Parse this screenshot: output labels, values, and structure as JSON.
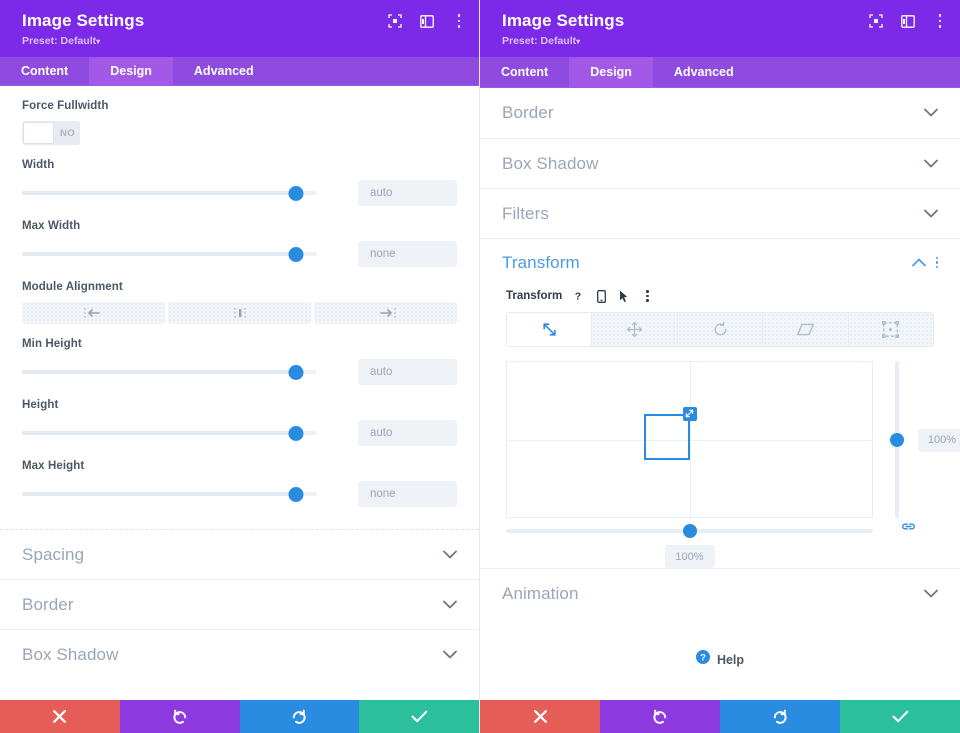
{
  "panels": [
    {
      "header": {
        "title": "Image Settings",
        "preset": "Preset: Default",
        "caret": "▾"
      },
      "tabs": [
        {
          "label": "Content",
          "active": false
        },
        {
          "label": "Design",
          "active": true
        },
        {
          "label": "Advanced",
          "active": false
        }
      ],
      "fields": [
        {
          "label": "Force Fullwidth",
          "type": "toggle",
          "value": "NO"
        },
        {
          "label": "Width",
          "type": "slider",
          "value": "auto",
          "thumb_pct": 93
        },
        {
          "label": "Max Width",
          "type": "slider",
          "value": "none",
          "thumb_pct": 93
        },
        {
          "label": "Module Alignment",
          "type": "align",
          "options": [
            "align-left",
            "align-center",
            "align-right"
          ]
        },
        {
          "label": "Min Height",
          "type": "slider",
          "value": "auto",
          "thumb_pct": 93
        },
        {
          "label": "Height",
          "type": "slider",
          "value": "auto",
          "thumb_pct": 93
        },
        {
          "label": "Max Height",
          "type": "slider",
          "value": "none",
          "thumb_pct": 93
        }
      ],
      "sections": [
        {
          "label": "Spacing",
          "open": false
        },
        {
          "label": "Border",
          "open": false
        },
        {
          "label": "Box Shadow",
          "open": false
        }
      ]
    },
    {
      "header": {
        "title": "Image Settings",
        "preset": "Preset: Default",
        "caret": "▾"
      },
      "tabs": [
        {
          "label": "Content",
          "active": false
        },
        {
          "label": "Design",
          "active": true
        },
        {
          "label": "Advanced",
          "active": false
        }
      ],
      "sections_top": [
        {
          "label": "Border",
          "open": false
        },
        {
          "label": "Box Shadow",
          "open": false
        },
        {
          "label": "Filters",
          "open": false
        }
      ],
      "transform": {
        "section_label": "Transform",
        "sub_label": "Transform",
        "meta_icons": [
          "help-icon",
          "mobile-icon",
          "cursor-icon",
          "more-options-icon"
        ],
        "modes": [
          {
            "name": "scale-icon",
            "active": true
          },
          {
            "name": "move-icon",
            "active": false
          },
          {
            "name": "rotate-icon",
            "active": false
          },
          {
            "name": "skew-icon",
            "active": false
          },
          {
            "name": "origin-icon",
            "active": false
          }
        ],
        "vertical_value": "100%",
        "horizontal_value": "100%",
        "vertical_thumb_pct": 50,
        "horizontal_thumb_pct": 50,
        "link_icon": "link-icon"
      },
      "sections_bottom": [
        {
          "label": "Animation",
          "open": false
        }
      ],
      "help": {
        "label": "Help",
        "icon": "help-circle-icon"
      }
    }
  ],
  "footer": {
    "buttons": [
      {
        "name": "cancel-button",
        "icon": "✖",
        "class": "cancel"
      },
      {
        "name": "undo-button",
        "icon": "↺",
        "class": "undo"
      },
      {
        "name": "redo-button",
        "icon": "↻",
        "class": "redo"
      },
      {
        "name": "save-button",
        "icon": "✔",
        "class": "save"
      }
    ]
  },
  "colors": {
    "header_purple": "#7C2AE8",
    "tabbar_purple": "#8F4BE0",
    "tab_active_purple": "#A259E8",
    "accent_blue": "#2a8ce0",
    "section_open_blue": "#4a9ce8",
    "cancel_red": "#e65c57",
    "undo_purple": "#8c3ae0",
    "redo_blue": "#2a8ce0",
    "save_green": "#2bbf9b"
  }
}
